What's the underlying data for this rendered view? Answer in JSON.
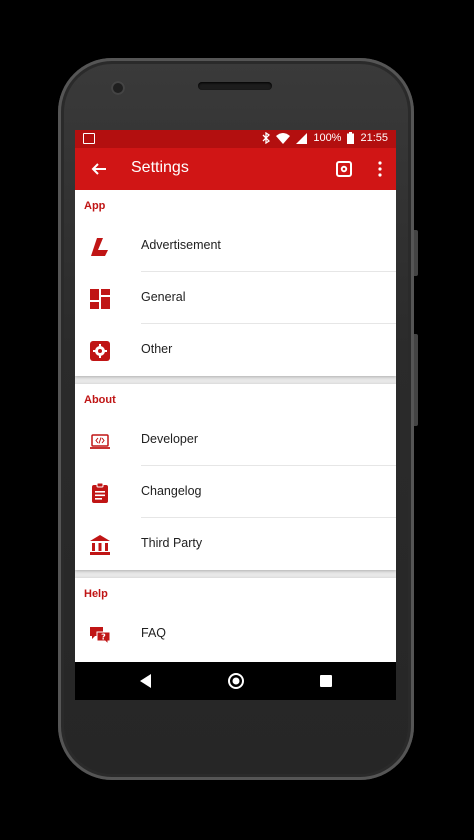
{
  "status": {
    "battery": "100%",
    "time": "21:55"
  },
  "appbar": {
    "title": "Settings"
  },
  "sections": [
    {
      "title": "App",
      "items": [
        {
          "label": "Advertisement"
        },
        {
          "label": "General"
        },
        {
          "label": "Other"
        }
      ]
    },
    {
      "title": "About",
      "items": [
        {
          "label": "Developer"
        },
        {
          "label": "Changelog"
        },
        {
          "label": "Third Party"
        }
      ]
    },
    {
      "title": "Help",
      "items": [
        {
          "label": "FAQ"
        }
      ]
    }
  ],
  "colors": {
    "primary": "#d01515",
    "primary_dark": "#b30f0f",
    "accent_text": "#c01515"
  }
}
